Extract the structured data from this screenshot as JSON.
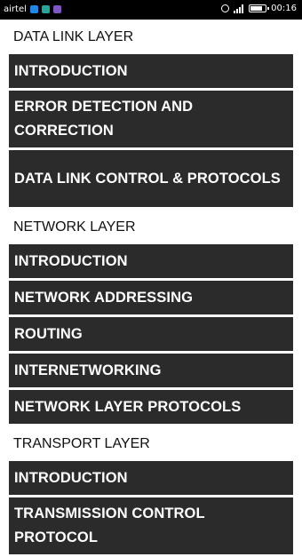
{
  "status_bar": {
    "carrier": "airtel",
    "time": "00:16",
    "icons": [
      "app-notification-icon-blue",
      "app-notification-icon-teal",
      "app-notification-icon-purple",
      "alarm-icon",
      "signal-icon",
      "battery-icon"
    ],
    "battery_level": 0.75
  },
  "sections": [
    {
      "title": "DATA LINK LAYER",
      "items": [
        {
          "label": "INTRODUCTION"
        },
        {
          "label": "ERROR DETECTION AND CORRECTION"
        },
        {
          "label": "DATA LINK CONTROL & PROTOCOLS"
        }
      ]
    },
    {
      "title": "NETWORK LAYER",
      "items": [
        {
          "label": "INTRODUCTION"
        },
        {
          "label": "NETWORK ADDRESSING"
        },
        {
          "label": "ROUTING"
        },
        {
          "label": "INTERNETWORKING"
        },
        {
          "label": "NETWORK LAYER PROTOCOLS"
        }
      ]
    },
    {
      "title": "TRANSPORT LAYER",
      "items": [
        {
          "label": "INTRODUCTION"
        },
        {
          "label": "TRANSMISSION CONTROL PROTOCOL"
        }
      ]
    }
  ],
  "colors": {
    "item_background": "#2b2b2b",
    "item_text": "#ffffff",
    "page_background": "#ffffff",
    "status_bar": "#000000"
  }
}
